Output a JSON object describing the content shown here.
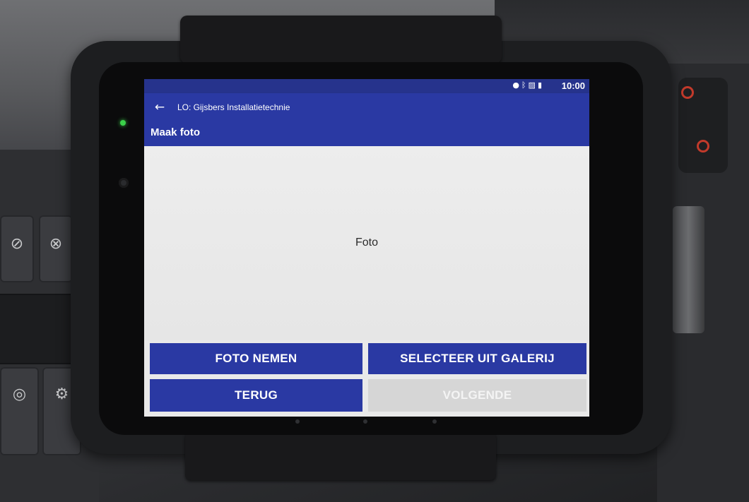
{
  "status_bar": {
    "icons": [
      "location-icon",
      "bluetooth-icon",
      "signal-icon",
      "battery-icon"
    ],
    "time": "10:00"
  },
  "toolbar": {
    "back_icon": "back-arrow-icon",
    "title": "LO: Gijsbers Installatietechnie"
  },
  "page": {
    "title": "Maak foto"
  },
  "photo_area": {
    "label": "Foto"
  },
  "buttons": {
    "take_photo": "FOTO NEMEN",
    "select_gallery": "SELECTEER UIT GALERIJ",
    "back": "TERUG",
    "next": "VOLGENDE"
  },
  "colors": {
    "app_bar": "#2a39a3",
    "status_bar": "#26338c",
    "button_primary": "#2a39a3",
    "button_disabled": "#d6d6d6",
    "content_bg": "#e9e9e9"
  }
}
